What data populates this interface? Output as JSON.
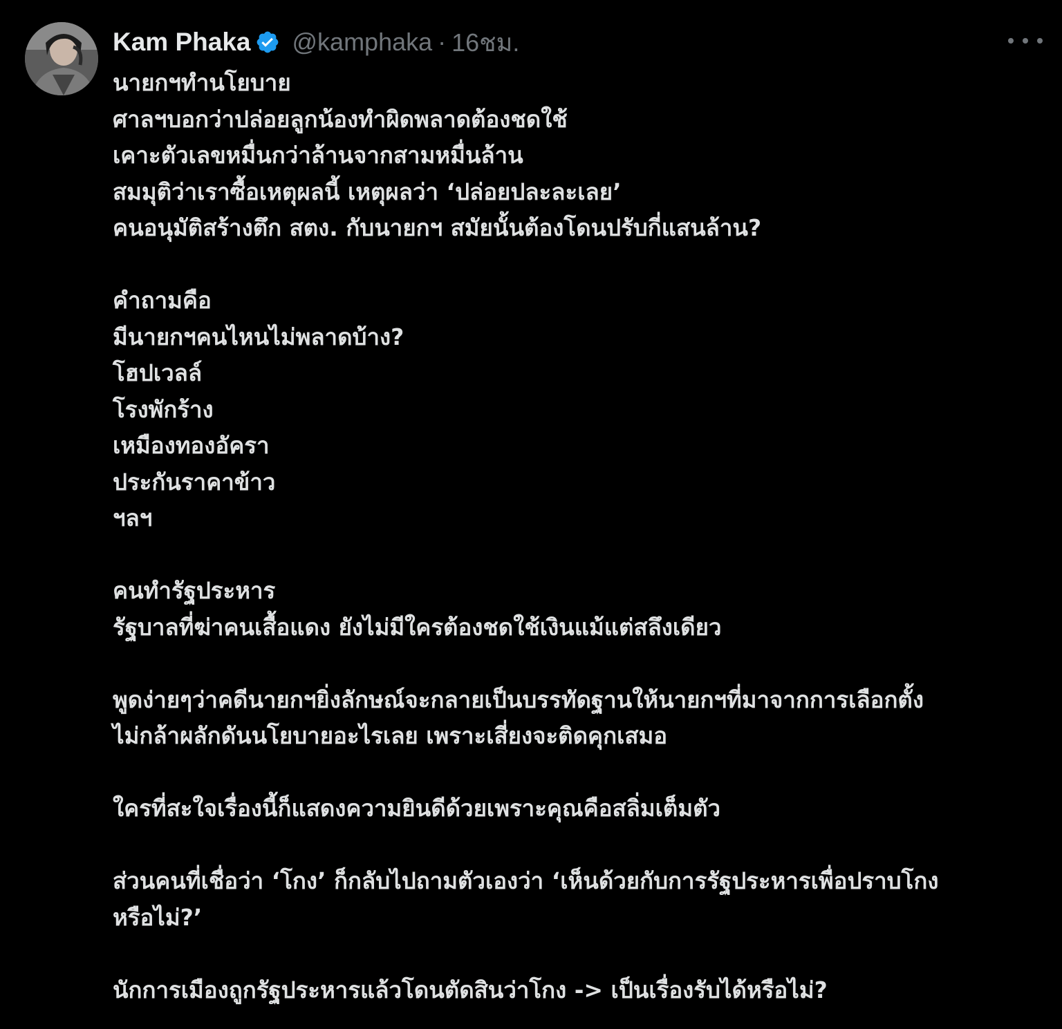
{
  "author": {
    "display_name": "Kam Phaka",
    "handle": "@kamphaka",
    "separator": "·",
    "time": "16ชม.",
    "verified_icon": "verified-badge-icon",
    "avatar_icon": "profile-avatar"
  },
  "more_icon": "more-horizontal-icon",
  "colors": {
    "background": "#000000",
    "text": "#e7e9ea",
    "muted": "#71767b",
    "verified": "#1d9bf0"
  },
  "body_lines": [
    "นายกฯทำนโยบาย",
    "ศาลฯบอกว่าปล่อยลูกน้องทำผิดพลาดต้องชดใช้",
    "เคาะตัวเลขหมื่นกว่าล้านจากสามหมื่นล้าน",
    "สมมุติว่าเราซื้อเหตุผลนี้ เหตุผลว่า ‘ปล่อยปละละเลย’",
    "คนอนุมัติสร้างตึก สตง. กับนายกฯ สมัยนั้นต้องโดนปรับกี่แสนล้าน?",
    "",
    "คำถามคือ",
    "มีนายกฯคนไหนไม่พลาดบ้าง?",
    "โฮปเวลล์",
    "โรงพักร้าง",
    "เหมืองทองอัครา",
    "ประกันราคาข้าว",
    "ฯลฯ",
    "",
    "คนทำรัฐประหาร",
    "รัฐบาลที่ฆ่าคนเสื้อแดง ยังไม่มีใครต้องชดใช้เงินแม้แต่สลึงเดียว",
    "",
    "พูดง่ายๆว่าคดีนายกฯยิ่งลักษณ์จะกลายเป็นบรรทัดฐานให้นายกฯที่มาจากการเลือกตั้ง",
    "ไม่กล้าผลักดันนโยบายอะไรเลย เพราะเสี่ยงจะติดคุกเสมอ",
    "",
    "ใครที่สะใจเรื่องนี้ก็แสดงความยินดีด้วยเพราะคุณคือสลิ่มเต็มตัว",
    "",
    "ส่วนคนที่เชื่อว่า ‘โกง’ ก็กลับไปถามตัวเองว่า ‘เห็นด้วยกับการรัฐประหารเพื่อปราบโกง",
    "หรือไม่?’",
    "",
    "นักการเมืองถูกรัฐประหารแล้วโดนตัดสินว่าโกง -> เป็นเรื่องรับได้หรือไม่?"
  ]
}
